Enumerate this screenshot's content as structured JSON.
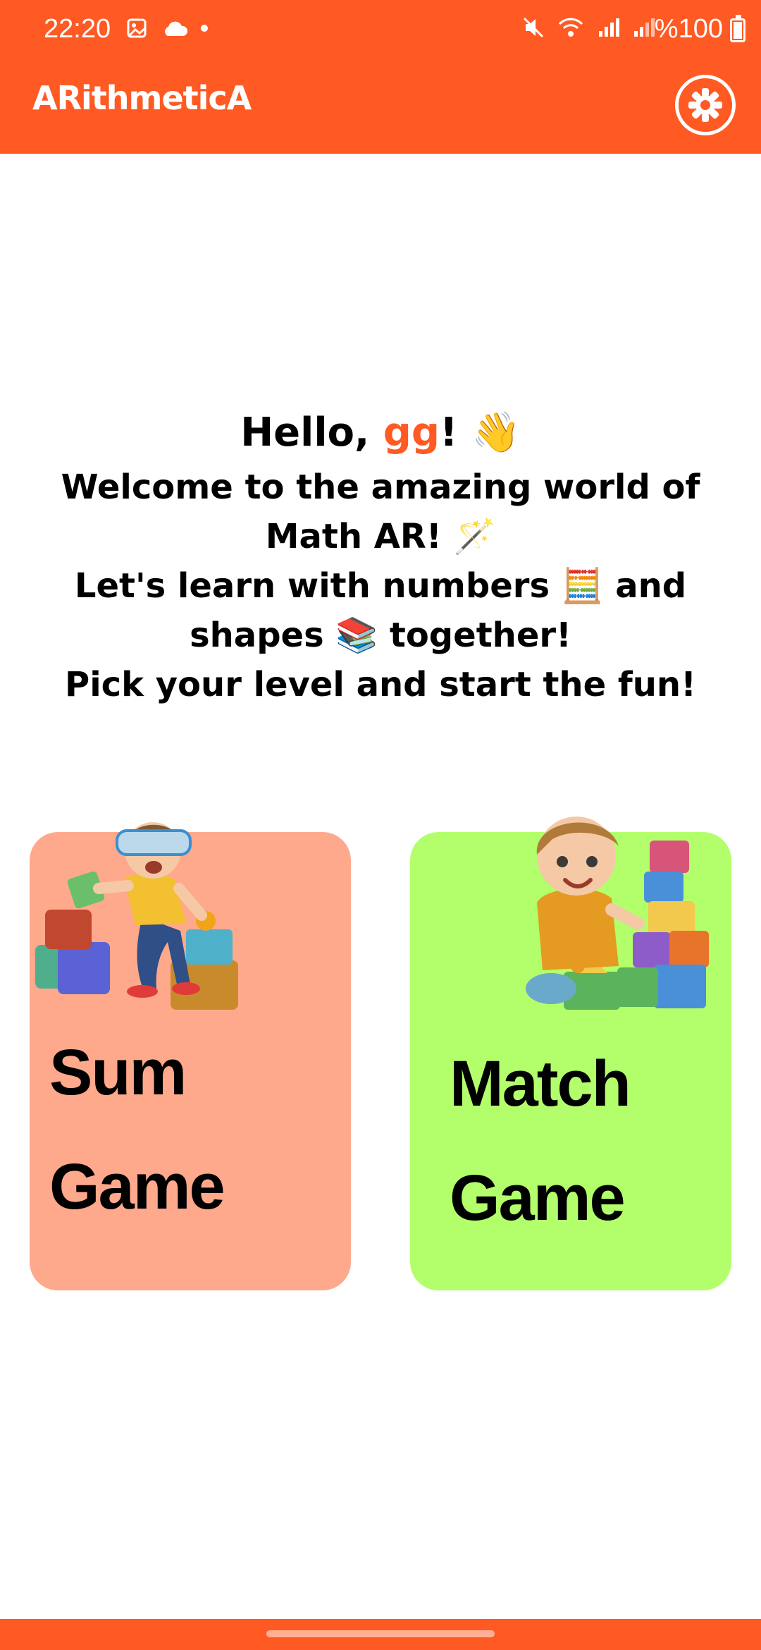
{
  "status_bar": {
    "time": "22:20",
    "battery": "%100"
  },
  "header": {
    "app_title": "ARithmeticA",
    "settings_icon": "gear-icon"
  },
  "greeting": {
    "hello": "Hello, ",
    "username": "gg",
    "hello_suffix": "! 👋",
    "line1": "Welcome to the amazing world of",
    "line2": "Math AR! 🪄",
    "line3": "Let's learn with numbers 🧮 and",
    "line4": "shapes 📚 together!",
    "line5": "Pick your level and start the fun!"
  },
  "cards": {
    "sum": {
      "line1": "Sum",
      "line2": "Game",
      "color": "#ffa98c"
    },
    "match": {
      "line1": "Match",
      "line2": "Game",
      "color": "#b3ff6b"
    }
  },
  "colors": {
    "brand": "#ff5a24"
  }
}
